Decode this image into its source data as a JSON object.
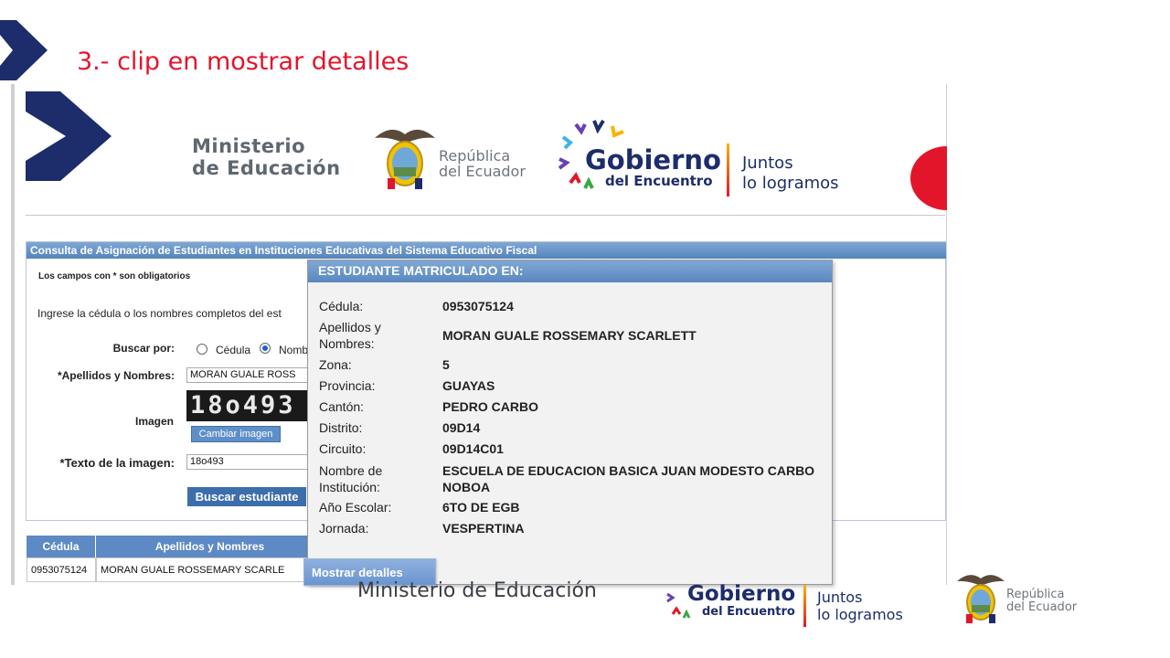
{
  "slide": {
    "title": "3.-  clip en mostrar detalles"
  },
  "header": {
    "ministerio_line1": "Ministerio",
    "ministerio_line2": "de Educación",
    "republica_line1": "República",
    "republica_line2": "del Ecuador",
    "gobierno": "Gobierno",
    "del_encuentro": "del Encuentro",
    "juntos_line1": "Juntos",
    "juntos_line2": "lo logramos"
  },
  "form": {
    "panel_title": "Consulta de Asignación de Estudiantes en Instituciones Educativas del Sistema Educativo Fiscal",
    "required_note": "Los campos con * son obligatorios",
    "instruction": "Ingrese la cédula o los nombres completos del est",
    "buscar_por_label": "Buscar por:",
    "radio_cedula": "Cédula",
    "radio_nombres": "Nomb",
    "apellidos_label": "*Apellidos y Nombres:",
    "apellidos_value": "MORAN GUALE ROSS",
    "imagen_label": "Imagen",
    "captcha_text": "18o493",
    "cambiar_imagen": "Cambiar imagen",
    "texto_imagen_label": "*Texto de la imagen:",
    "texto_imagen_value": "18o493",
    "buscar_button": "Buscar estudiante"
  },
  "table": {
    "headers": [
      "Cédula",
      "Apellidos y Nombres"
    ],
    "row": {
      "cedula": "0953075124",
      "nombres": "MORAN GUALE ROSSEMARY SCARLE"
    }
  },
  "modal": {
    "title": "ESTUDIANTE MATRICULADO EN:",
    "fields": [
      {
        "label": "Cédula:",
        "value": "0953075124"
      },
      {
        "label": "Apellidos y Nombres:",
        "value": "MORAN GUALE ROSSEMARY SCARLETT"
      },
      {
        "label": "Zona:",
        "value": "5"
      },
      {
        "label": "Provincia:",
        "value": "GUAYAS"
      },
      {
        "label": "Cantón:",
        "value": "PEDRO CARBO"
      },
      {
        "label": "Distrito:",
        "value": "09D14"
      },
      {
        "label": "Circuito:",
        "value": "09D14C01"
      },
      {
        "label": "Nombre de Institución:",
        "value": "ESCUELA DE EDUCACION BASICA JUAN MODESTO CARBO NOBOA"
      },
      {
        "label": "Año Escolar:",
        "value": "6TO DE EGB"
      },
      {
        "label": "Jornada:",
        "value": "VESPERTINA"
      }
    ],
    "mostrar_detalles": "Mostrar detalles"
  },
  "footer": {
    "ministerio": "Ministerio de Educación",
    "gobierno": "Gobierno",
    "del_encuentro": "del Encuentro",
    "juntos_line1": "Juntos",
    "juntos_line2": "lo logramos",
    "republica_line1": "República",
    "republica_line2": "del Ecuador"
  },
  "colors": {
    "accent_red": "#e3152b",
    "navy": "#1d2d6b",
    "header_blue": "#5d8ac4"
  },
  "icons": [
    "chevron-logo-icon",
    "coat-of-arms-icon",
    "gobierno-arrows-icon",
    "radio-icon"
  ]
}
